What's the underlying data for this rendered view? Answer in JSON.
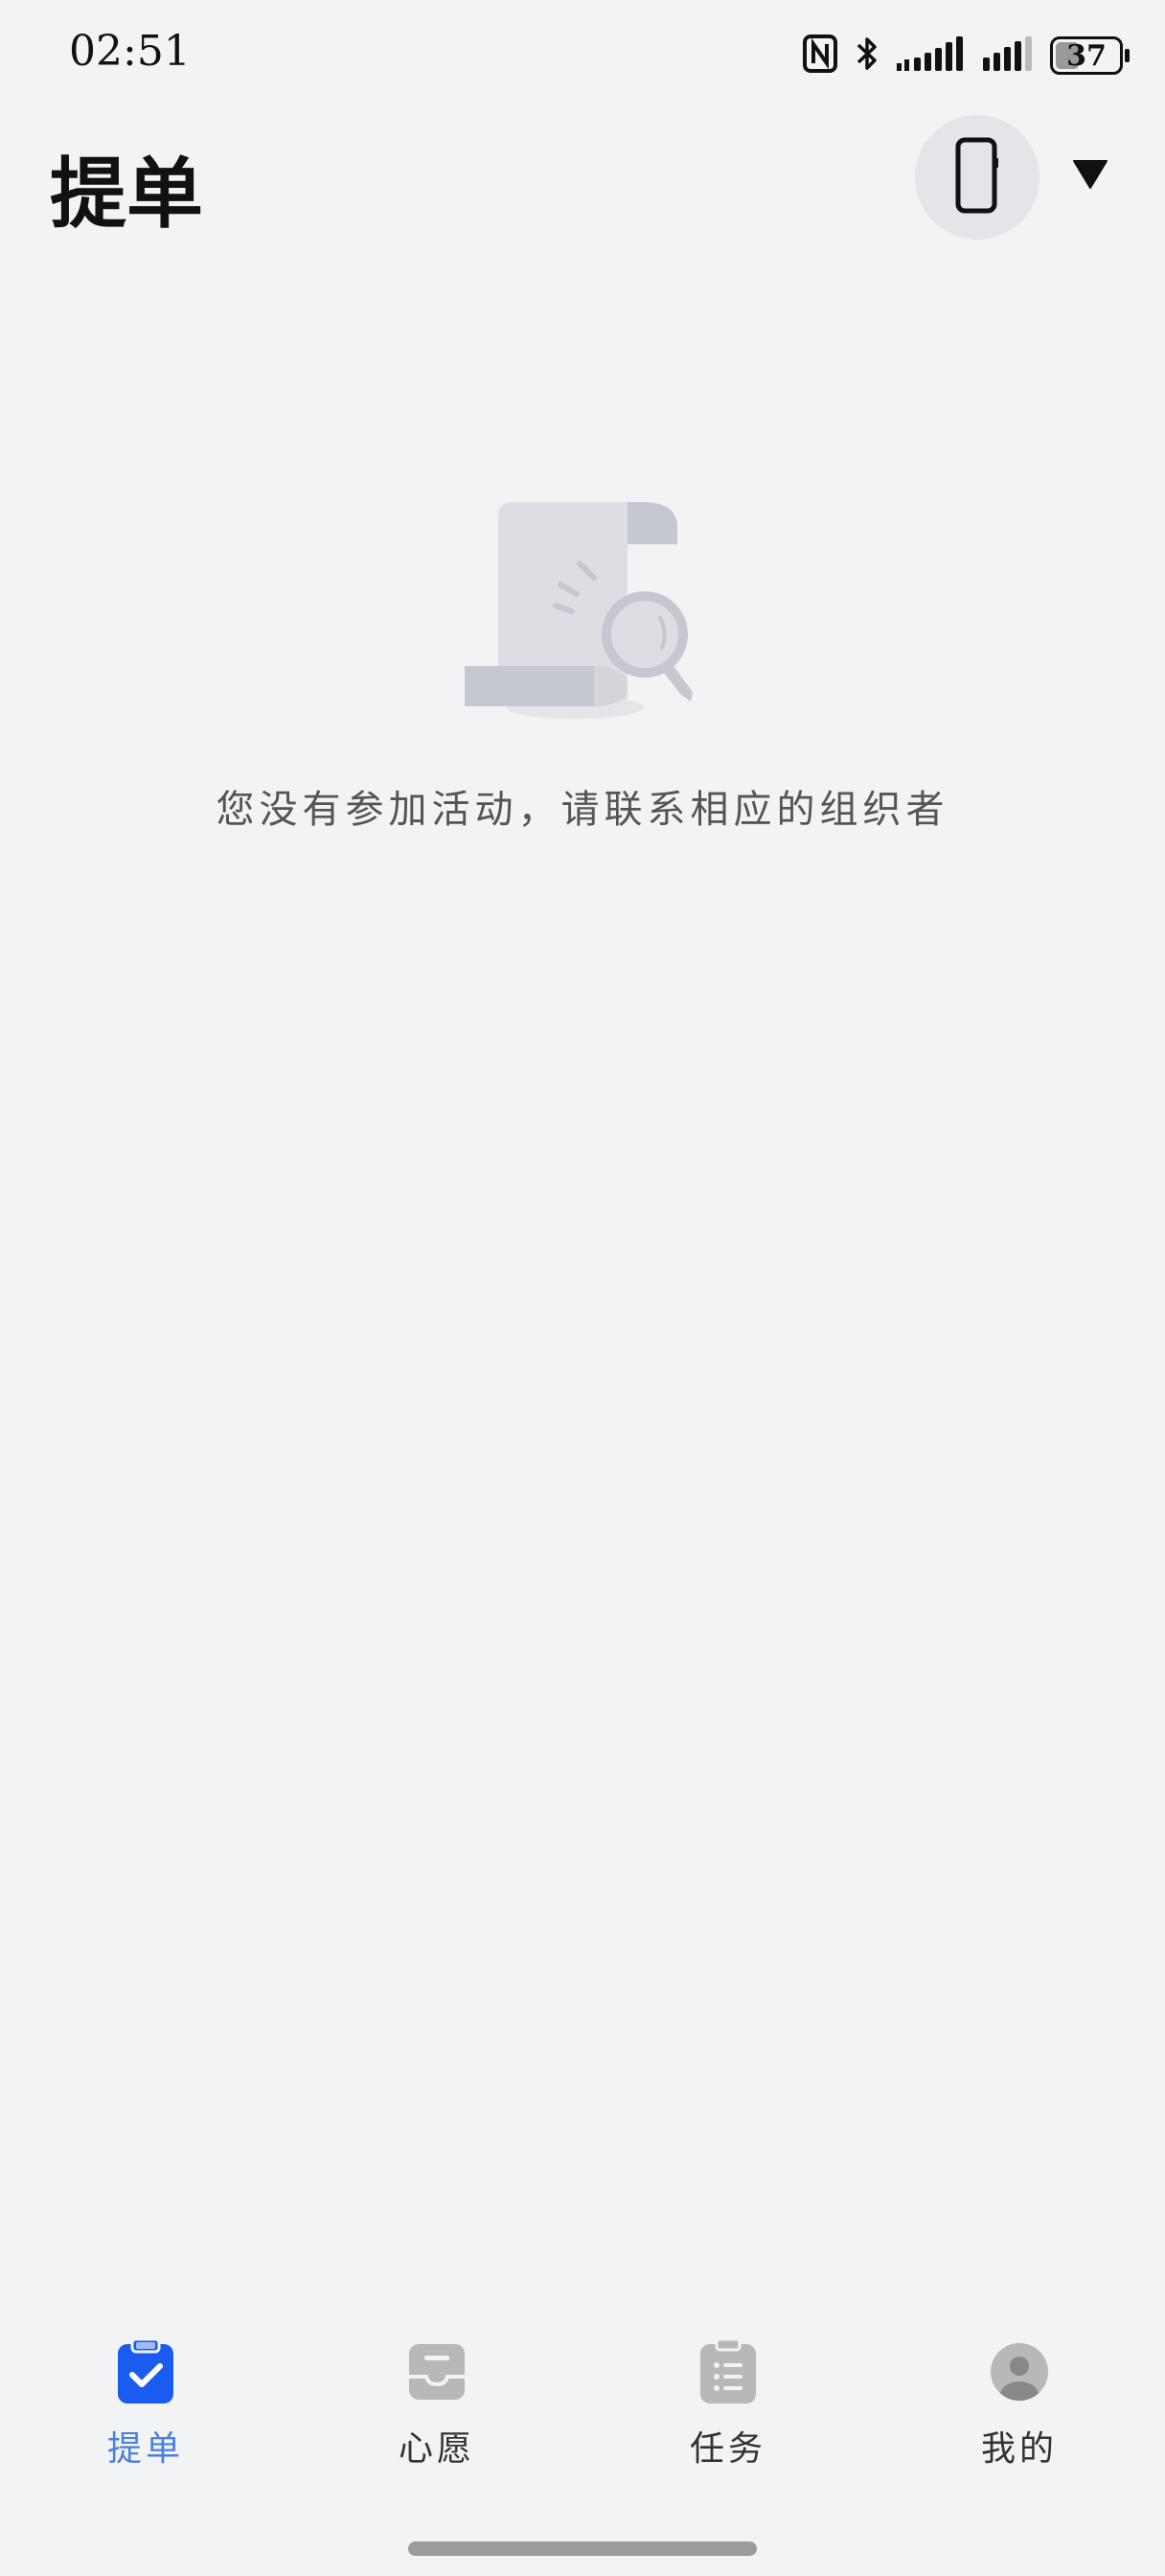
{
  "status_bar": {
    "time": "02:51",
    "battery": 37,
    "icons": [
      "nfc-icon",
      "bluetooth-icon",
      "signal-icon",
      "signal-icon",
      "battery-icon"
    ]
  },
  "header": {
    "title": "提单",
    "device_icon": "phone-icon",
    "dropdown_icon": "triangle-down-icon"
  },
  "empty_state": {
    "illustration": "document-search-illustration",
    "message": "您没有参加活动，请联系相应的组织者"
  },
  "bottom_nav": {
    "active_color": "#1a5cf0",
    "active_label_color": "#4a7fe0",
    "inactive_color": "#b8b8b8",
    "items": [
      {
        "label": "提单",
        "icon": "clipboard-check-icon",
        "active": true
      },
      {
        "label": "心愿",
        "icon": "inbox-icon",
        "active": false
      },
      {
        "label": "任务",
        "icon": "clipboard-list-icon",
        "active": false
      },
      {
        "label": "我的",
        "icon": "user-icon",
        "active": false
      }
    ]
  }
}
